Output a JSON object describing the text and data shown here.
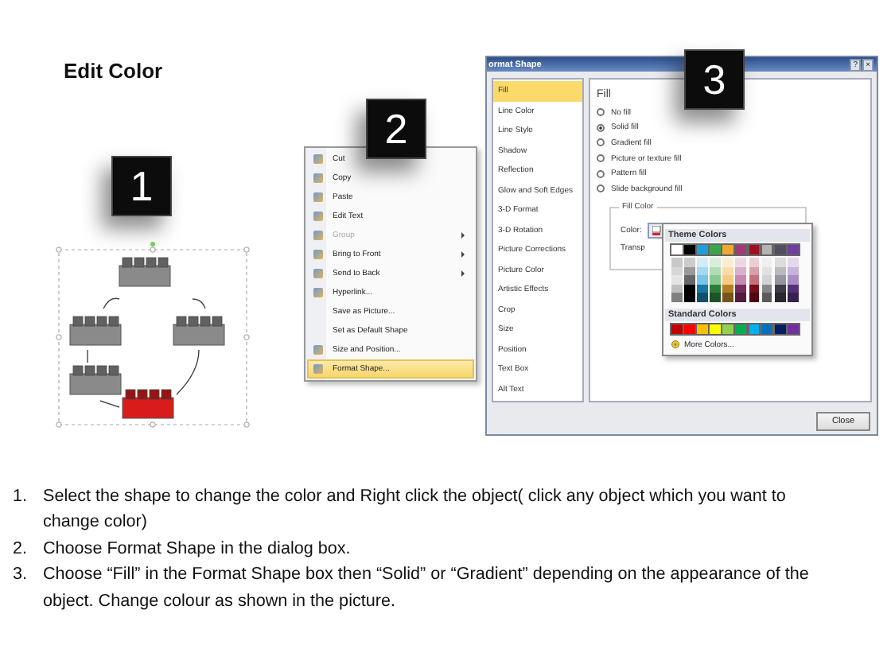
{
  "slide_title": "Edit Color",
  "badges": [
    "1",
    "2",
    "3"
  ],
  "context_menu": {
    "items": [
      {
        "label": "Cut",
        "icon": true,
        "disabled": false,
        "submenu": false,
        "selected": false
      },
      {
        "label": "Copy",
        "icon": true,
        "disabled": false,
        "submenu": false,
        "selected": false
      },
      {
        "label": "Paste",
        "icon": true,
        "disabled": false,
        "submenu": false,
        "selected": false
      },
      {
        "label": "Edit Text",
        "icon": true,
        "disabled": false,
        "submenu": false,
        "selected": false
      },
      {
        "label": "Group",
        "icon": true,
        "disabled": true,
        "submenu": true,
        "selected": false
      },
      {
        "label": "Bring to Front",
        "icon": true,
        "disabled": false,
        "submenu": true,
        "selected": false
      },
      {
        "label": "Send to Back",
        "icon": true,
        "disabled": false,
        "submenu": true,
        "selected": false
      },
      {
        "label": "Hyperlink...",
        "icon": true,
        "disabled": false,
        "submenu": false,
        "selected": false
      },
      {
        "label": "Save as Picture...",
        "icon": false,
        "disabled": false,
        "submenu": false,
        "selected": false
      },
      {
        "label": "Set as Default Shape",
        "icon": false,
        "disabled": false,
        "submenu": false,
        "selected": false
      },
      {
        "label": "Size and Position...",
        "icon": true,
        "disabled": false,
        "submenu": false,
        "selected": false
      },
      {
        "label": "Format Shape...",
        "icon": true,
        "disabled": false,
        "submenu": false,
        "selected": true
      }
    ]
  },
  "dialog": {
    "title": "ormat Shape",
    "help": "?",
    "close_x": "×",
    "nav": [
      {
        "label": "Fill",
        "selected": true
      },
      {
        "label": "Line Color",
        "selected": false
      },
      {
        "label": "Line Style",
        "selected": false
      },
      {
        "label": "Shadow",
        "selected": false
      },
      {
        "label": "Reflection",
        "selected": false
      },
      {
        "label": "Glow and Soft Edges",
        "selected": false
      },
      {
        "label": "3-D Format",
        "selected": false
      },
      {
        "label": "3-D Rotation",
        "selected": false
      },
      {
        "label": "Picture Corrections",
        "selected": false
      },
      {
        "label": "Picture Color",
        "selected": false
      },
      {
        "label": "Artistic Effects",
        "selected": false
      },
      {
        "label": "Crop",
        "selected": false
      },
      {
        "label": "Size",
        "selected": false
      },
      {
        "label": "Position",
        "selected": false
      },
      {
        "label": "Text Box",
        "selected": false
      },
      {
        "label": "Alt Text",
        "selected": false
      }
    ],
    "fill_heading": "Fill",
    "fill_options": [
      {
        "label": "No fill",
        "selected": false
      },
      {
        "label": "Solid fill",
        "selected": true
      },
      {
        "label": "Gradient fill",
        "selected": false
      },
      {
        "label": "Picture or texture fill",
        "selected": false
      },
      {
        "label": "Pattern fill",
        "selected": false
      },
      {
        "label": "Slide background fill",
        "selected": false
      }
    ],
    "group_title": "Fill Color",
    "color_label": "Color:",
    "transparency_label": "Transp",
    "palette": {
      "theme_title": "Theme Colors",
      "theme_colors": [
        {
          "color": "#ffffff"
        },
        {
          "color": "#000000"
        },
        {
          "color": "#1e9fdc"
        },
        {
          "color": "#3aa54a"
        },
        {
          "color": "#f0a830"
        },
        {
          "color": "#a03a7a"
        },
        {
          "color": "#a01020"
        },
        {
          "color": "#b4b4b4"
        },
        {
          "color": "#505060"
        },
        {
          "color": "#7040a0"
        }
      ],
      "standard_title": "Standard Colors",
      "standard_colors": [
        {
          "color": "#c00000"
        },
        {
          "color": "#ff0000"
        },
        {
          "color": "#ffc000"
        },
        {
          "color": "#ffff00"
        },
        {
          "color": "#92d050"
        },
        {
          "color": "#00b050"
        },
        {
          "color": "#00b0f0"
        },
        {
          "color": "#0070c0"
        },
        {
          "color": "#002060"
        },
        {
          "color": "#7030a0"
        }
      ],
      "more": "More Colors..."
    },
    "close": "Close"
  },
  "instructions": [
    {
      "number": "1.",
      "text": "Select the shape to change the color and Right click the object( click any object which you want to change color)"
    },
    {
      "number": "2.",
      "text": "Choose Format Shape in the dialog box."
    },
    {
      "number": "3.",
      "text": "Choose “Fill” in the Format Shape box then “Solid” or “Gradient” depending on the appearance of the object. Change colour as shown in the picture."
    }
  ]
}
